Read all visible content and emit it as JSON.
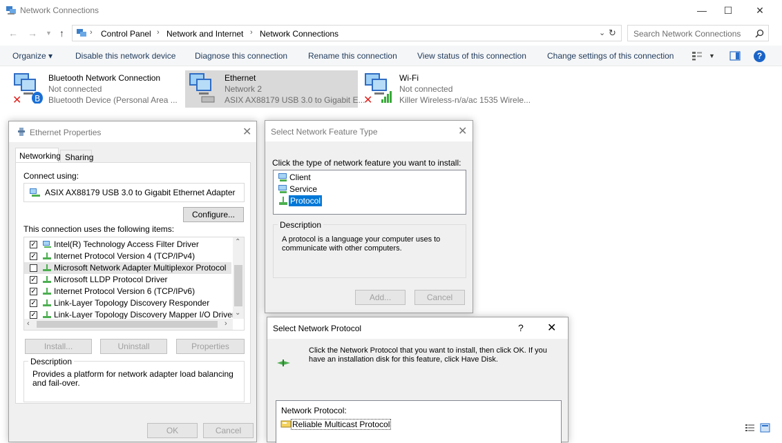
{
  "window": {
    "title": "Network Connections",
    "search_placeholder": "Search Network Connections",
    "breadcrumb": [
      "Control Panel",
      "Network and Internet",
      "Network Connections"
    ]
  },
  "commands": {
    "organize": "Organize ▾",
    "disable": "Disable this network device",
    "diagnose": "Diagnose this connection",
    "rename": "Rename this connection",
    "view_status": "View status of this connection",
    "change_settings": "Change settings of this connection"
  },
  "connections": [
    {
      "name": "Bluetooth Network Connection",
      "status": "Not connected",
      "device": "Bluetooth Device (Personal Area ..."
    },
    {
      "name": "Ethernet",
      "status": "Network 2",
      "device": "ASIX AX88179 USB 3.0 to Gigabit E..."
    },
    {
      "name": "Wi-Fi",
      "status": "Not connected",
      "device": "Killer Wireless-n/a/ac 1535 Wirele..."
    }
  ],
  "ethernet_properties": {
    "title": "Ethernet Properties",
    "tabs": [
      "Networking",
      "Sharing"
    ],
    "connect_using_label": "Connect using:",
    "adapter": "ASIX AX88179 USB 3.0 to Gigabit Ethernet Adapter",
    "configure": "Configure...",
    "items_label": "This connection uses the following items:",
    "items": [
      {
        "label": "Intel(R) Technology Access Filter Driver",
        "checked": true
      },
      {
        "label": "Internet Protocol Version 4 (TCP/IPv4)",
        "checked": true
      },
      {
        "label": "Microsoft Network Adapter Multiplexor Protocol",
        "checked": false
      },
      {
        "label": "Microsoft LLDP Protocol Driver",
        "checked": true
      },
      {
        "label": "Internet Protocol Version 6 (TCP/IPv6)",
        "checked": true
      },
      {
        "label": "Link-Layer Topology Discovery Responder",
        "checked": true
      },
      {
        "label": "Link-Layer Topology Discovery Mapper I/O Driver",
        "checked": true
      }
    ],
    "install": "Install...",
    "uninstall": "Uninstall",
    "properties": "Properties",
    "description_label": "Description",
    "description": "Provides a platform for network adapter load balancing and fail-over.",
    "ok": "OK",
    "cancel": "Cancel"
  },
  "feature_type": {
    "title": "Select Network Feature Type",
    "prompt": "Click the type of network feature you want to install:",
    "types": [
      "Client",
      "Service",
      "Protocol"
    ],
    "selected": "Protocol",
    "description_label": "Description",
    "description": "A protocol is a language your computer uses to communicate with other computers.",
    "add": "Add...",
    "cancel": "Cancel"
  },
  "network_protocol": {
    "title": "Select Network Protocol",
    "help": "?",
    "instructions": "Click the Network Protocol that you want to install, then click OK. If you have an installation disk for this feature, click Have Disk.",
    "list_label": "Network Protocol:",
    "items": [
      "Reliable Multicast Protocol"
    ]
  }
}
